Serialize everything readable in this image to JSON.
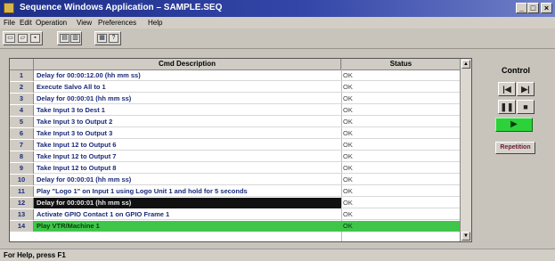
{
  "window": {
    "title": "Sequence Windows Application – SAMPLE.SEQ",
    "minimize_label": "_",
    "maximize_label": "□",
    "close_label": "×"
  },
  "menu": [
    "File",
    "Edit",
    "Operation",
    "View",
    "Preferences",
    "Help"
  ],
  "toolbar": {
    "icons": [
      "new-icon",
      "open-icon",
      "save-icon",
      "print-icon",
      "copy-icon",
      "paste-icon",
      "help-icon"
    ]
  },
  "grid": {
    "headers": {
      "description": "Cmd Description",
      "status": "Status"
    },
    "rows": [
      {
        "num": "1",
        "desc": "Delay for 00:00:12.00 (hh mm ss)",
        "status": "OK",
        "style": ""
      },
      {
        "num": "2",
        "desc": "Execute Salvo All to 1",
        "status": "OK",
        "style": ""
      },
      {
        "num": "3",
        "desc": "Delay for 00:00:01 (hh mm ss)",
        "status": "OK",
        "style": ""
      },
      {
        "num": "4",
        "desc": "Take Input 3 to Dest 1",
        "status": "OK",
        "style": ""
      },
      {
        "num": "5",
        "desc": "Take Input 3 to Output 2",
        "status": "OK",
        "style": ""
      },
      {
        "num": "6",
        "desc": "Take Input 3 to Output 3",
        "status": "OK",
        "style": ""
      },
      {
        "num": "7",
        "desc": "Take Input 12 to Output 6",
        "status": "OK",
        "style": ""
      },
      {
        "num": "8",
        "desc": "Take Input 12 to Output 7",
        "status": "OK",
        "style": ""
      },
      {
        "num": "9",
        "desc": "Take Input 12 to Output 8",
        "status": "OK",
        "style": ""
      },
      {
        "num": "10",
        "desc": "Delay for 00:00:01 (hh mm ss)",
        "status": "OK",
        "style": ""
      },
      {
        "num": "11",
        "desc": "Play \"Logo 1\" on Input 1 using Logo Unit 1 and hold for 5 seconds",
        "status": "OK",
        "style": ""
      },
      {
        "num": "12",
        "desc": "Delay for 00:00:01 (hh mm ss)",
        "status": "OK",
        "style": "black"
      },
      {
        "num": "13",
        "desc": "Activate GPIO Contact 1 on GPIO Frame 1",
        "status": "OK",
        "style": ""
      },
      {
        "num": "14",
        "desc": "Play VTR/Machine 1",
        "status": "OK",
        "style": "green"
      }
    ]
  },
  "control": {
    "title": "Control",
    "skip_back_label": "|◀",
    "skip_forward_label": "▶|",
    "pause_label": "❚❚",
    "stop_label": "■",
    "play_label": "▶",
    "repetition_label": "Repetition"
  },
  "status_bar": {
    "text": "For Help, press F1"
  },
  "colors": {
    "titlebar": "#1d2f88",
    "play_green": "#2bd23a",
    "active_row": "#3fc64a"
  }
}
